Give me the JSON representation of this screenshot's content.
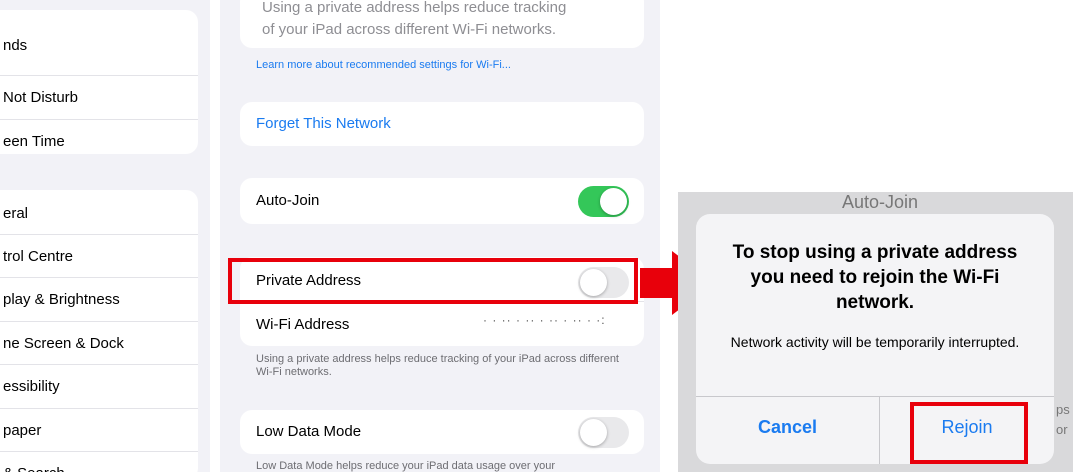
{
  "sidebar": {
    "group1": [
      "nds",
      "Not Disturb",
      "een Time"
    ],
    "group2": [
      "eral",
      "trol Centre",
      "play & Brightness",
      "ne Screen & Dock",
      "essibility",
      "paper",
      "& Search"
    ]
  },
  "wifi": {
    "top_note_line1": "Using a private address helps reduce tracking",
    "top_note_line2": "of your iPad across different Wi-Fi networks.",
    "learn_more": "Learn more about recommended settings for Wi-Fi...",
    "forget": "Forget This Network",
    "auto_join": "Auto-Join",
    "private_address": "Private Address",
    "wifi_address_label": "Wi-Fi Address",
    "wifi_address_value": "· · ·· · ·· · ·· · ·· · ·:",
    "private_note": "Using a private address helps reduce tracking of your iPad across different Wi-Fi networks.",
    "low_data_mode": "Low Data Mode",
    "low_data_note": "Low Data Mode helps reduce your iPad data usage over your"
  },
  "dialog": {
    "bg_title": "Auto-Join",
    "title": "To stop using a private address you need to rejoin the Wi-Fi network.",
    "message": "Network activity will be temporarily interrupted.",
    "cancel": "Cancel",
    "rejoin": "Rejoin",
    "side_fragment_1": "ps",
    "side_fragment_2": "or"
  },
  "colors": {
    "accent": "#1a7bf0",
    "toggle_on": "#34c759",
    "toggle_off": "#e9e9eb",
    "highlight": "#e8000b"
  }
}
